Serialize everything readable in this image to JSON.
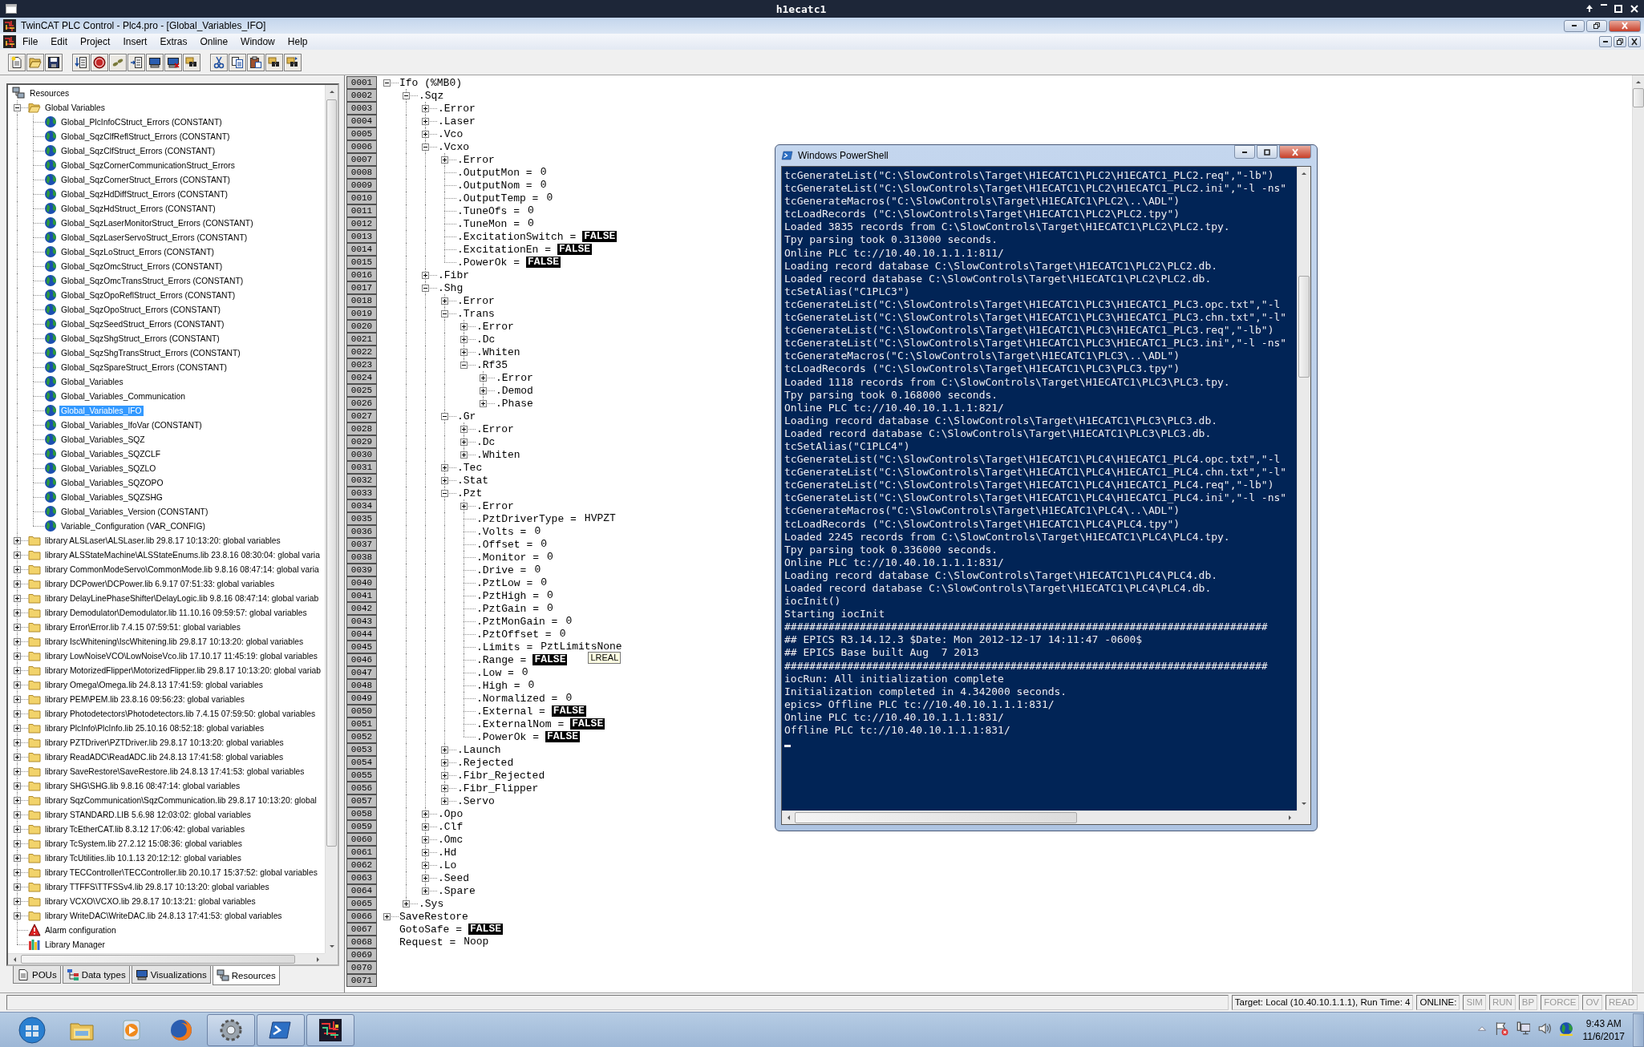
{
  "desktop_window": {
    "title": "h1ecatc1"
  },
  "window": {
    "title": "TwinCAT PLC Control - Plc4.pro - [Global_Variables_IFO]"
  },
  "menu": [
    "File",
    "Edit",
    "Project",
    "Insert",
    "Extras",
    "Online",
    "Window",
    "Help"
  ],
  "toolbar_groups": [
    [
      {
        "kind": "new"
      },
      {
        "kind": "open"
      },
      {
        "kind": "save"
      }
    ],
    [
      {
        "kind": "download-list"
      },
      {
        "kind": "stop"
      },
      {
        "kind": "footsteps"
      },
      {
        "kind": "login-list"
      },
      {
        "kind": "monitor"
      },
      {
        "kind": "monitor-x"
      },
      {
        "kind": "binoculars-folder"
      }
    ],
    [
      {
        "kind": "cut"
      },
      {
        "kind": "copy"
      },
      {
        "kind": "paste"
      },
      {
        "kind": "find"
      },
      {
        "kind": "find-next"
      }
    ]
  ],
  "resources_tree": {
    "root": "Resources",
    "items": [
      {
        "label": "Global Variables",
        "kind": "folder",
        "expanded": true,
        "selected": false,
        "children": [
          {
            "label": "Global_PlcInfoCStruct_Errors (CONSTANT)",
            "kind": "globals",
            "selected": false
          },
          {
            "label": "Global_SqzClfReflStruct_Errors (CONSTANT)",
            "kind": "globals",
            "selected": false
          },
          {
            "label": "Global_SqzClfStruct_Errors (CONSTANT)",
            "kind": "globals",
            "selected": false
          },
          {
            "label": "Global_SqzCornerCommunicationStruct_Errors",
            "kind": "globals",
            "selected": false
          },
          {
            "label": "Global_SqzCornerStruct_Errors (CONSTANT)",
            "kind": "globals",
            "selected": false
          },
          {
            "label": "Global_SqzHdDiffStruct_Errors (CONSTANT)",
            "kind": "globals",
            "selected": false
          },
          {
            "label": "Global_SqzHdStruct_Errors (CONSTANT)",
            "kind": "globals",
            "selected": false
          },
          {
            "label": "Global_SqzLaserMonitorStruct_Errors (CONSTANT)",
            "kind": "globals",
            "selected": false
          },
          {
            "label": "Global_SqzLaserServoStruct_Errors (CONSTANT)",
            "kind": "globals",
            "selected": false
          },
          {
            "label": "Global_SqzLoStruct_Errors (CONSTANT)",
            "kind": "globals",
            "selected": false
          },
          {
            "label": "Global_SqzOmcStruct_Errors (CONSTANT)",
            "kind": "globals",
            "selected": false
          },
          {
            "label": "Global_SqzOmcTransStruct_Errors (CONSTANT)",
            "kind": "globals",
            "selected": false
          },
          {
            "label": "Global_SqzOpoReflStruct_Errors (CONSTANT)",
            "kind": "globals",
            "selected": false
          },
          {
            "label": "Global_SqzOpoStruct_Errors (CONSTANT)",
            "kind": "globals",
            "selected": false
          },
          {
            "label": "Global_SqzSeedStruct_Errors (CONSTANT)",
            "kind": "globals",
            "selected": false
          },
          {
            "label": "Global_SqzShgStruct_Errors (CONSTANT)",
            "kind": "globals",
            "selected": false
          },
          {
            "label": "Global_SqzShgTransStruct_Errors (CONSTANT)",
            "kind": "globals",
            "selected": false
          },
          {
            "label": "Global_SqzSpareStruct_Errors (CONSTANT)",
            "kind": "globals",
            "selected": false
          },
          {
            "label": "Global_Variables",
            "kind": "globals",
            "selected": false
          },
          {
            "label": "Global_Variables_Communication",
            "kind": "globals",
            "selected": false
          },
          {
            "label": "Global_Variables_IFO",
            "kind": "globals",
            "selected": true
          },
          {
            "label": "Global_Variables_IfoVar (CONSTANT)",
            "kind": "globals",
            "selected": false
          },
          {
            "label": "Global_Variables_SQZ",
            "kind": "globals",
            "selected": false
          },
          {
            "label": "Global_Variables_SQZCLF",
            "kind": "globals",
            "selected": false
          },
          {
            "label": "Global_Variables_SQZLO",
            "kind": "globals",
            "selected": false
          },
          {
            "label": "Global_Variables_SQZOPO",
            "kind": "globals",
            "selected": false
          },
          {
            "label": "Global_Variables_SQZSHG",
            "kind": "globals",
            "selected": false
          },
          {
            "label": "Global_Variables_Version (CONSTANT)",
            "kind": "globals",
            "selected": false
          },
          {
            "label": "Variable_Configuration (VAR_CONFIG)",
            "kind": "globals",
            "selected": false
          }
        ]
      },
      {
        "label": "library ALSLaser\\ALSLaser.lib 29.8.17 10:13:20: global variables",
        "kind": "library",
        "expanded": false,
        "selected": false
      },
      {
        "label": "library ALSStateMachine\\ALSStateEnums.lib 23.8.16 08:30:04: global varia",
        "kind": "library",
        "expanded": false,
        "selected": false
      },
      {
        "label": "library CommonModeServo\\CommonMode.lib 9.8.16 08:47:14: global varia",
        "kind": "library",
        "expanded": false,
        "selected": false
      },
      {
        "label": "library DCPower\\DCPower.lib 6.9.17 07:51:33: global variables",
        "kind": "library",
        "expanded": false,
        "selected": false
      },
      {
        "label": "library DelayLinePhaseShifter\\DelayLogic.lib 9.8.16 08:47:14: global variab",
        "kind": "library",
        "expanded": false,
        "selected": false
      },
      {
        "label": "library Demodulator\\Demodulator.lib 11.10.16 09:59:57: global variables",
        "kind": "library",
        "expanded": false,
        "selected": false
      },
      {
        "label": "library Error\\Error.lib 7.4.15 07:59:51: global variables",
        "kind": "library",
        "expanded": false,
        "selected": false
      },
      {
        "label": "library IscWhitening\\IscWhitening.lib 29.8.17 10:13:20: global variables",
        "kind": "library",
        "expanded": false,
        "selected": false
      },
      {
        "label": "library LowNoiseVCO\\LowNoiseVco.lib 17.10.17 11:45:19: global variables",
        "kind": "library",
        "expanded": false,
        "selected": false
      },
      {
        "label": "library MotorizedFlipper\\MotorizedFlipper.lib 29.8.17 10:13:20: global variab",
        "kind": "library",
        "expanded": false,
        "selected": false
      },
      {
        "label": "library Omega\\Omega.lib 24.8.13 17:41:59: global variables",
        "kind": "library",
        "expanded": false,
        "selected": false
      },
      {
        "label": "library PEM\\PEM.lib 23.8.16 09:56:23: global variables",
        "kind": "library",
        "expanded": false,
        "selected": false
      },
      {
        "label": "library Photodetectors\\Photodetectors.lib 7.4.15 07:59:50: global variables",
        "kind": "library",
        "expanded": false,
        "selected": false
      },
      {
        "label": "library PlcInfo\\PlcInfo.lib 25.10.16 08:52:18: global variables",
        "kind": "library",
        "expanded": false,
        "selected": false
      },
      {
        "label": "library PZTDriver\\PZTDriver.lib 29.8.17 10:13:20: global variables",
        "kind": "library",
        "expanded": false,
        "selected": false
      },
      {
        "label": "library ReadADC\\ReadADC.lib 24.8.13 17:41:58: global variables",
        "kind": "library",
        "expanded": false,
        "selected": false
      },
      {
        "label": "library SaveRestore\\SaveRestore.lib 24.8.13 17:41:53: global variables",
        "kind": "library",
        "expanded": false,
        "selected": false
      },
      {
        "label": "library SHG\\SHG.lib 9.8.16 08:47:14: global variables",
        "kind": "library",
        "expanded": false,
        "selected": false
      },
      {
        "label": "library SqzCommunication\\SqzCommunication.lib 29.8.17 10:13:20: global",
        "kind": "library",
        "expanded": false,
        "selected": false
      },
      {
        "label": "library STANDARD.LIB 5.6.98 12:03:02: global variables",
        "kind": "library",
        "expanded": false,
        "selected": false
      },
      {
        "label": "library TcEtherCAT.lib 8.3.12 17:06:42: global variables",
        "kind": "library",
        "expanded": false,
        "selected": false
      },
      {
        "label": "library TcSystem.lib 27.2.12 15:08:36: global variables",
        "kind": "library",
        "expanded": false,
        "selected": false
      },
      {
        "label": "library TcUtilities.lib 10.1.13 20:12:12: global variables",
        "kind": "library",
        "expanded": false,
        "selected": false
      },
      {
        "label": "library TECController\\TECController.lib 20.10.17 15:37:52: global variables",
        "kind": "library",
        "expanded": false,
        "selected": false
      },
      {
        "label": "library TTFFS\\TTFSSv4.lib 29.8.17 10:13:20: global variables",
        "kind": "library",
        "expanded": false,
        "selected": false
      },
      {
        "label": "library VCXO\\VCXO.lib 29.8.17 10:13:21: global variables",
        "kind": "library",
        "expanded": false,
        "selected": false
      },
      {
        "label": "library WriteDAC\\WriteDAC.lib 24.8.13 17:41:53: global variables",
        "kind": "library",
        "expanded": false,
        "selected": false
      },
      {
        "label": "Alarm configuration",
        "kind": "alarm",
        "selected": false
      },
      {
        "label": "Library Manager",
        "kind": "library-manager",
        "selected": false
      }
    ]
  },
  "panel_tabs": [
    {
      "label": "POUs",
      "kind": "document",
      "selected": false
    },
    {
      "label": "Data types",
      "kind": "types",
      "selected": false
    },
    {
      "label": "Visualizations",
      "kind": "monitor",
      "selected": false
    },
    {
      "label": "Resources",
      "kind": "network",
      "selected": true
    }
  ],
  "editor": {
    "line_numbers": [
      "0001",
      "0002",
      "0003",
      "0004",
      "0005",
      "0006",
      "0007",
      "0008",
      "0009",
      "0010",
      "0011",
      "0012",
      "0013",
      "0014",
      "0015",
      "0016",
      "0017",
      "0018",
      "0019",
      "0020",
      "0021",
      "0022",
      "0023",
      "0024",
      "0025",
      "0026",
      "0027",
      "0028",
      "0029",
      "0030",
      "0031",
      "0032",
      "0033",
      "0034",
      "0035",
      "0036",
      "0037",
      "0038",
      "0039",
      "0040",
      "0041",
      "0042",
      "0043",
      "0044",
      "0045",
      "0046",
      "0047",
      "0048",
      "0049",
      "0050",
      "0051",
      "0052",
      "0053",
      "0054",
      "0055",
      "0056",
      "0057",
      "0058",
      "0059",
      "0060",
      "0061",
      "0062",
      "0063",
      "0064",
      "0065",
      "0066",
      "0067",
      "0068",
      "0069",
      "0070",
      "0071"
    ],
    "tree": [
      {
        "label": "Ifo (%MB0)",
        "expanded": true,
        "children": [
          {
            "label": ".Sqz",
            "expanded": true,
            "children": [
              {
                "label": ".Error",
                "expanded": false
              },
              {
                "label": ".Laser",
                "expanded": false
              },
              {
                "label": ".Vco",
                "expanded": false
              },
              {
                "label": ".Vcxo",
                "expanded": true,
                "children": [
                  {
                    "label": ".Error",
                    "expanded": false
                  },
                  {
                    "label": ".OutputMon =",
                    "value": "0",
                    "inverted": false
                  },
                  {
                    "label": ".OutputNom =",
                    "value": "0",
                    "inverted": false
                  },
                  {
                    "label": ".OutputTemp =",
                    "value": "0",
                    "inverted": false
                  },
                  {
                    "label": ".TuneOfs =",
                    "value": "0",
                    "inverted": false
                  },
                  {
                    "label": ".TuneMon =",
                    "value": "0",
                    "inverted": false
                  },
                  {
                    "label": ".ExcitationSwitch =",
                    "value": "FALSE",
                    "inverted": true
                  },
                  {
                    "label": ".ExcitationEn =",
                    "value": "FALSE",
                    "inverted": true
                  },
                  {
                    "label": ".PowerOk =",
                    "value": "FALSE",
                    "inverted": true
                  }
                ]
              },
              {
                "label": ".Fibr",
                "expanded": false
              },
              {
                "label": ".Shg",
                "expanded": true,
                "children": [
                  {
                    "label": ".Error",
                    "expanded": false
                  },
                  {
                    "label": ".Trans",
                    "expanded": true,
                    "children": [
                      {
                        "label": ".Error",
                        "expanded": false
                      },
                      {
                        "label": ".Dc",
                        "expanded": false
                      },
                      {
                        "label": ".Whiten",
                        "expanded": false
                      },
                      {
                        "label": ".Rf35",
                        "expanded": true,
                        "children": [
                          {
                            "label": ".Error",
                            "expanded": false
                          },
                          {
                            "label": ".Demod",
                            "expanded": false
                          },
                          {
                            "label": ".Phase",
                            "expanded": false
                          }
                        ]
                      }
                    ]
                  },
                  {
                    "label": ".Gr",
                    "expanded": true,
                    "children": [
                      {
                        "label": ".Error",
                        "expanded": false
                      },
                      {
                        "label": ".Dc",
                        "expanded": false
                      },
                      {
                        "label": ".Whiten",
                        "expanded": false
                      }
                    ]
                  },
                  {
                    "label": ".Tec",
                    "expanded": false
                  },
                  {
                    "label": ".Stat",
                    "expanded": false
                  },
                  {
                    "label": ".Pzt",
                    "expanded": true,
                    "children": [
                      {
                        "label": ".Error",
                        "expanded": false
                      },
                      {
                        "label": ".PztDriverType =",
                        "value": "HVPZT",
                        "inverted": false
                      },
                      {
                        "label": ".Volts =",
                        "value": "0",
                        "inverted": false
                      },
                      {
                        "label": ".Offset =",
                        "value": "0",
                        "inverted": false
                      },
                      {
                        "label": ".Monitor =",
                        "value": "0",
                        "inverted": false
                      },
                      {
                        "label": ".Drive =",
                        "value": "0",
                        "inverted": false
                      },
                      {
                        "label": ".PztLow =",
                        "value": "0",
                        "inverted": false
                      },
                      {
                        "label": ".PztHigh =",
                        "value": "0",
                        "inverted": false
                      },
                      {
                        "label": ".PztGain =",
                        "value": "0",
                        "inverted": false
                      },
                      {
                        "label": ".PztMonGain =",
                        "value": "0",
                        "inverted": false
                      },
                      {
                        "label": ".PztOffset =",
                        "value": "0",
                        "inverted": false
                      },
                      {
                        "label": ".Limits =",
                        "value": "PztLimitsNone",
                        "inverted": false
                      },
                      {
                        "label": ".Range =",
                        "value": "FALSE",
                        "inverted": true,
                        "tooltip": "LREAL"
                      },
                      {
                        "label": ".Low =",
                        "value": "0",
                        "inverted": false
                      },
                      {
                        "label": ".High =",
                        "value": "0",
                        "inverted": false
                      },
                      {
                        "label": ".Normalized =",
                        "value": "0",
                        "inverted": false
                      },
                      {
                        "label": ".External =",
                        "value": "FALSE",
                        "inverted": true
                      },
                      {
                        "label": ".ExternalNom =",
                        "value": "FALSE",
                        "inverted": true
                      },
                      {
                        "label": ".PowerOk =",
                        "value": "FALSE",
                        "inverted": true
                      }
                    ]
                  },
                  {
                    "label": ".Launch",
                    "expanded": false
                  },
                  {
                    "label": ".Rejected",
                    "expanded": false
                  },
                  {
                    "label": ".Fibr_Rejected",
                    "expanded": false
                  },
                  {
                    "label": ".Fibr_Flipper",
                    "expanded": false
                  },
                  {
                    "label": ".Servo",
                    "expanded": false
                  }
                ]
              },
              {
                "label": ".Opo",
                "expanded": false
              },
              {
                "label": ".Clf",
                "expanded": false
              },
              {
                "label": ".Omc",
                "expanded": false
              },
              {
                "label": ".Hd",
                "expanded": false
              },
              {
                "label": ".Lo",
                "expanded": false
              },
              {
                "label": ".Seed",
                "expanded": false
              },
              {
                "label": ".Spare",
                "expanded": false
              }
            ]
          },
          {
            "label": ".Sys",
            "expanded": false
          }
        ]
      },
      {
        "label": "SaveRestore",
        "expanded": false
      },
      {
        "label": "GotoSafe =",
        "value": "FALSE",
        "inverted": true
      },
      {
        "label": "Request =",
        "value": "Noop",
        "inverted": false
      }
    ]
  },
  "powershell": {
    "title": "Windows PowerShell",
    "lines": [
      "tcGenerateList(\"C:\\SlowControls\\Target\\H1ECATC1\\PLC2\\H1ECATC1_PLC2.req\",\"-lb\")",
      "tcGenerateList(\"C:\\SlowControls\\Target\\H1ECATC1\\PLC2\\H1ECATC1_PLC2.ini\",\"-l -ns\"",
      "tcGenerateMacros(\"C:\\SlowControls\\Target\\H1ECATC1\\PLC2\\..\\ADL\")",
      "tcLoadRecords (\"C:\\SlowControls\\Target\\H1ECATC1\\PLC2\\PLC2.tpy\")",
      "Loaded 3835 records from C:\\SlowControls\\Target\\H1ECATC1\\PLC2\\PLC2.tpy.",
      "Tpy parsing took 0.313000 seconds.",
      "Online PLC tc://10.40.10.1.1.1:811/",
      "Loading record database C:\\SlowControls\\Target\\H1ECATC1\\PLC2\\PLC2.db.",
      "Loaded record database C:\\SlowControls\\Target\\H1ECATC1\\PLC2\\PLC2.db.",
      "tcSetAlias(\"C1PLC3\")",
      "tcGenerateList(\"C:\\SlowControls\\Target\\H1ECATC1\\PLC3\\H1ECATC1_PLC3.opc.txt\",\"-l",
      "tcGenerateList(\"C:\\SlowControls\\Target\\H1ECATC1\\PLC3\\H1ECATC1_PLC3.chn.txt\",\"-l\"",
      "tcGenerateList(\"C:\\SlowControls\\Target\\H1ECATC1\\PLC3\\H1ECATC1_PLC3.req\",\"-lb\")",
      "tcGenerateList(\"C:\\SlowControls\\Target\\H1ECATC1\\PLC3\\H1ECATC1_PLC3.ini\",\"-l -ns\"",
      "tcGenerateMacros(\"C:\\SlowControls\\Target\\H1ECATC1\\PLC3\\..\\ADL\")",
      "tcLoadRecords (\"C:\\SlowControls\\Target\\H1ECATC1\\PLC3\\PLC3.tpy\")",
      "Loaded 1118 records from C:\\SlowControls\\Target\\H1ECATC1\\PLC3\\PLC3.tpy.",
      "Tpy parsing took 0.168000 seconds.",
      "Online PLC tc://10.40.10.1.1.1:821/",
      "Loading record database C:\\SlowControls\\Target\\H1ECATC1\\PLC3\\PLC3.db.",
      "Loaded record database C:\\SlowControls\\Target\\H1ECATC1\\PLC3\\PLC3.db.",
      "tcSetAlias(\"C1PLC4\")",
      "tcGenerateList(\"C:\\SlowControls\\Target\\H1ECATC1\\PLC4\\H1ECATC1_PLC4.opc.txt\",\"-l",
      "tcGenerateList(\"C:\\SlowControls\\Target\\H1ECATC1\\PLC4\\H1ECATC1_PLC4.chn.txt\",\"-l\"",
      "tcGenerateList(\"C:\\SlowControls\\Target\\H1ECATC1\\PLC4\\H1ECATC1_PLC4.req\",\"-lb\")",
      "tcGenerateList(\"C:\\SlowControls\\Target\\H1ECATC1\\PLC4\\H1ECATC1_PLC4.ini\",\"-l -ns\"",
      "tcGenerateMacros(\"C:\\SlowControls\\Target\\H1ECATC1\\PLC4\\..\\ADL\")",
      "tcLoadRecords (\"C:\\SlowControls\\Target\\H1ECATC1\\PLC4\\PLC4.tpy\")",
      "Loaded 2245 records from C:\\SlowControls\\Target\\H1ECATC1\\PLC4\\PLC4.tpy.",
      "Tpy parsing took 0.336000 seconds.",
      "Online PLC tc://10.40.10.1.1.1:831/",
      "Loading record database C:\\SlowControls\\Target\\H1ECATC1\\PLC4\\PLC4.db.",
      "Loaded record database C:\\SlowControls\\Target\\H1ECATC1\\PLC4\\PLC4.db.",
      "iocInit()",
      "Starting iocInit",
      "#############################################################################",
      "## EPICS R3.14.12.3 $Date: Mon 2012-12-17 14:11:47 -0600$",
      "## EPICS Base built Aug  7 2013",
      "#############################################################################",
      "iocRun: All initialization complete",
      "Initialization completed in 4.342000 seconds.",
      "epics> Offline PLC tc://10.40.10.1.1.1:831/",
      "Online PLC tc://10.40.10.1.1.1:831/",
      "Offline PLC tc://10.40.10.1.1.1:831/"
    ]
  },
  "status_bar": {
    "target": "Target: Local (10.40.10.1.1.1), Run Time: 4",
    "mode": "ONLINE:",
    "flags": [
      {
        "label": "SIM",
        "active": false
      },
      {
        "label": "RUN",
        "active": false
      },
      {
        "label": "BP",
        "active": false
      },
      {
        "label": "FORCE",
        "active": false
      },
      {
        "label": "OV",
        "active": false
      },
      {
        "label": "READ",
        "active": false
      }
    ]
  },
  "taskbar": {
    "apps": [
      {
        "kind": "explorer",
        "running": false
      },
      {
        "kind": "media-player",
        "running": false
      },
      {
        "kind": "firefox",
        "running": false
      },
      {
        "kind": "gear",
        "running": true
      },
      {
        "kind": "powershell",
        "running": true
      },
      {
        "kind": "twincat",
        "running": true
      }
    ],
    "tray": [
      {
        "kind": "show-hidden"
      },
      {
        "kind": "flag"
      },
      {
        "kind": "network"
      },
      {
        "kind": "speaker"
      },
      {
        "kind": "app"
      }
    ],
    "time": "9:43 AM",
    "date": "11/6/2017"
  }
}
